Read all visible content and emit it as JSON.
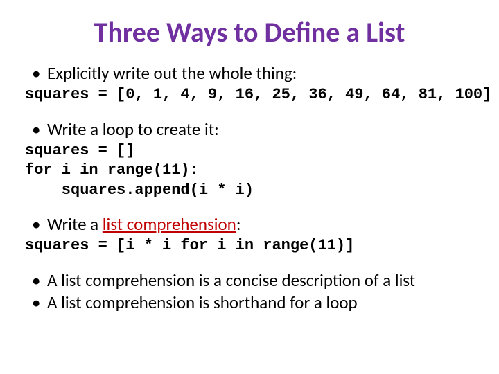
{
  "title": "Three Ways to Define a List",
  "bullet1": "Explicitly write out the whole thing:",
  "code1": "squares = [0, 1, 4, 9, 16, 25, 36, 49, 64, 81, 100]",
  "bullet2": "Write a loop to create it:",
  "code2": "squares = []\nfor i in range(11):\n    squares.append(i * i)",
  "bullet3_a": "Write a ",
  "bullet3_kw": "list comprehension",
  "bullet3_b": ":",
  "code3": "squares = [i * i for i in range(11)]",
  "bullet4": "A list comprehension is a concise description of a list",
  "bullet5": "A list comprehension is shorthand for a loop",
  "dot": "•"
}
